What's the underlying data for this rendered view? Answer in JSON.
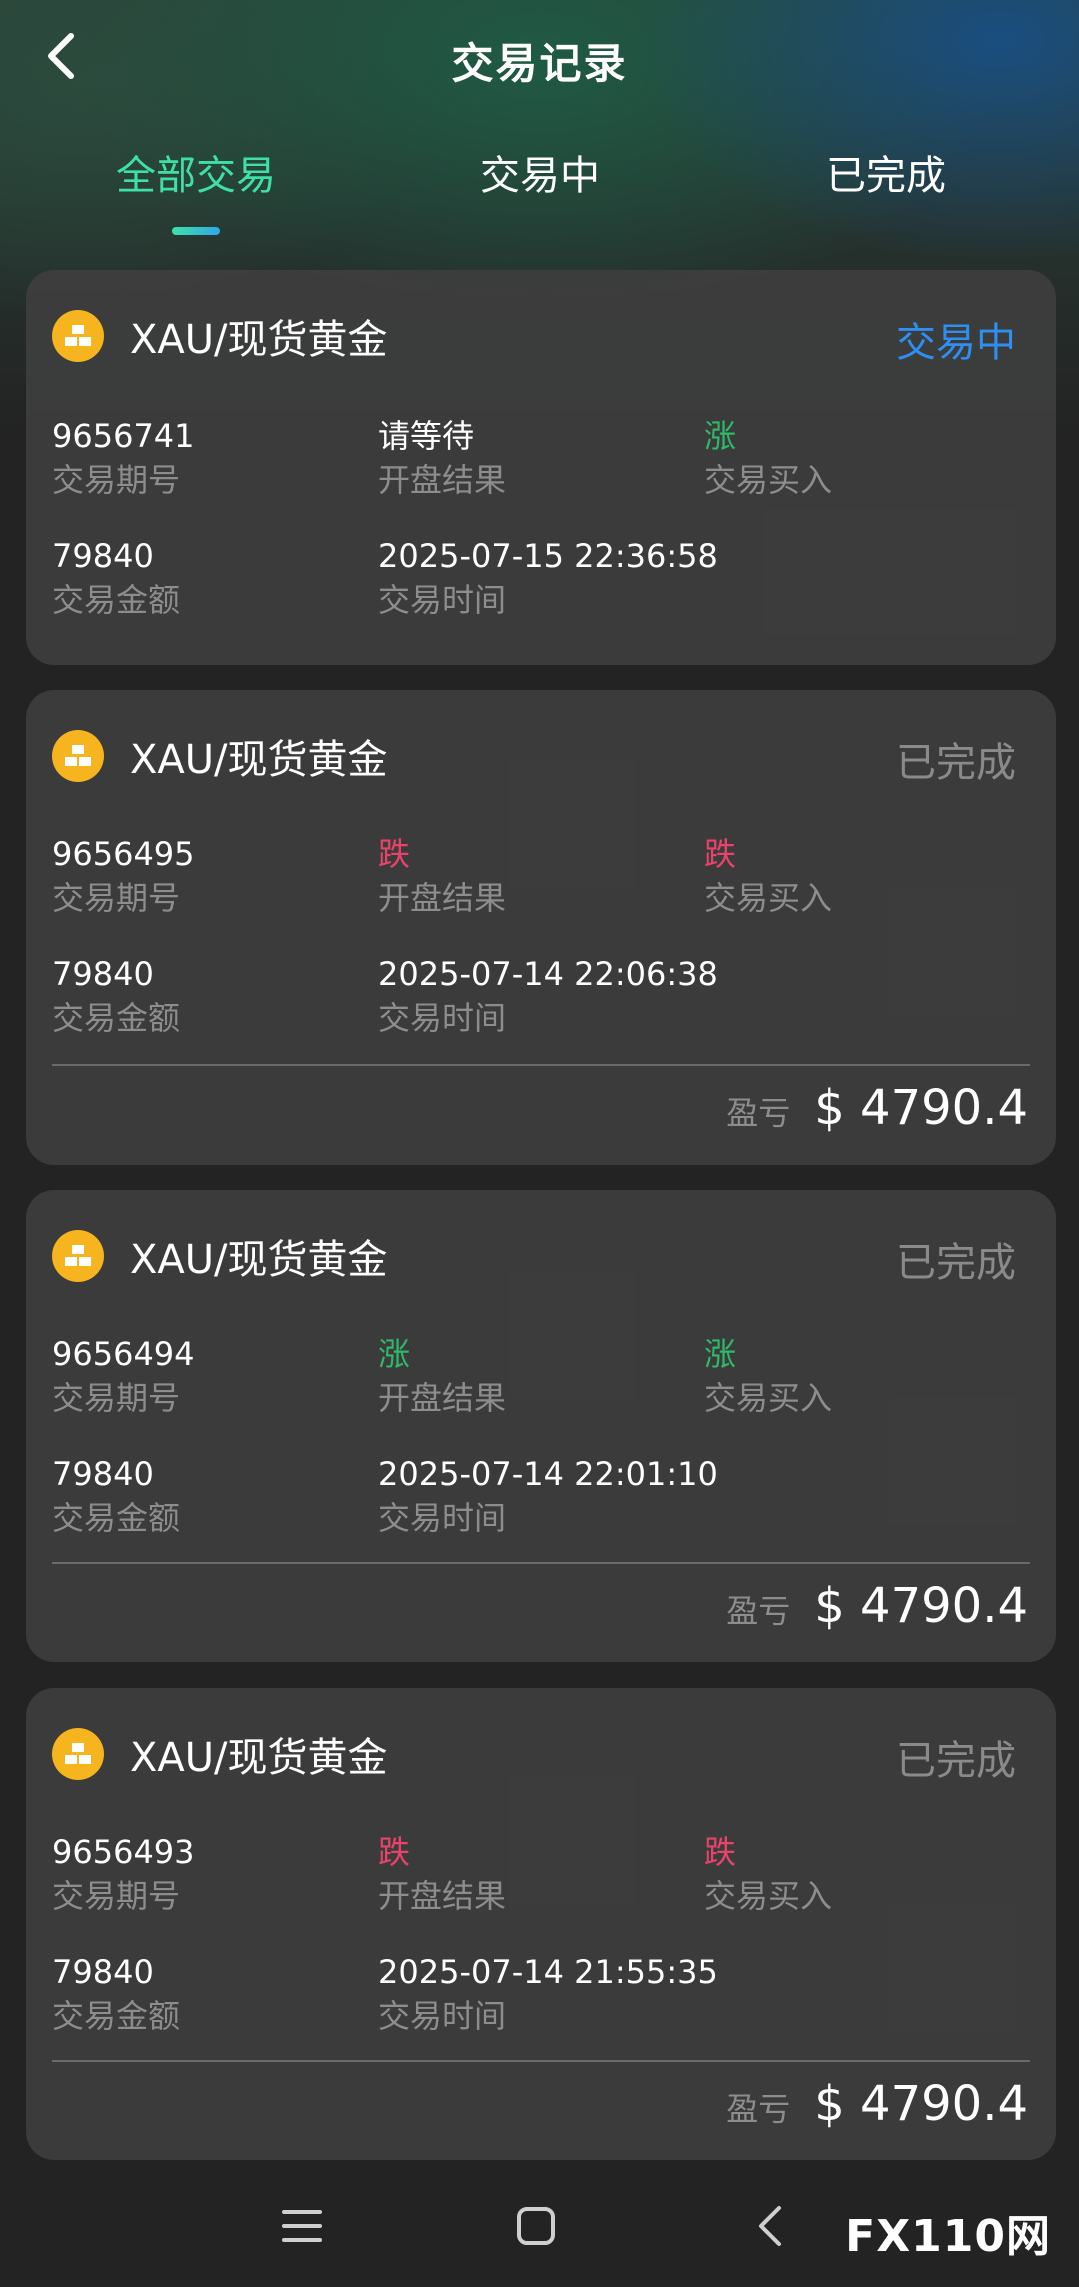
{
  "header": {
    "title": "交易记录"
  },
  "tabs": [
    {
      "label": "全部交易",
      "active": true
    },
    {
      "label": "交易中",
      "active": false
    },
    {
      "label": "已完成",
      "active": false
    }
  ],
  "labels": {
    "period": "交易期号",
    "result": "开盘结果",
    "buy": "交易买入",
    "amount": "交易金额",
    "time": "交易时间",
    "pnl": "盈亏"
  },
  "trades": [
    {
      "symbol": "XAU/现货黄金",
      "status": "交易中",
      "period": "9656741",
      "result": "请等待",
      "buy": "涨",
      "amount": "79840",
      "time": "2025-07-15 22:36:58",
      "pnl": null
    },
    {
      "symbol": "XAU/现货黄金",
      "status": "已完成",
      "period": "9656495",
      "result": "跌",
      "buy": "跌",
      "amount": "79840",
      "time": "2025-07-14 22:06:38",
      "pnl": "$ 4790.4"
    },
    {
      "symbol": "XAU/现货黄金",
      "status": "已完成",
      "period": "9656494",
      "result": "涨",
      "buy": "涨",
      "amount": "79840",
      "time": "2025-07-14 22:01:10",
      "pnl": "$ 4790.4"
    },
    {
      "symbol": "XAU/现货黄金",
      "status": "已完成",
      "period": "9656493",
      "result": "跌",
      "buy": "跌",
      "amount": "79840",
      "time": "2025-07-14 21:55:35",
      "pnl": "$ 4790.4"
    }
  ],
  "colors": {
    "accent_tab": "#3fe0a6",
    "ongoing": "#2f8ff0",
    "up": "#2fb86a",
    "down": "#e8436a",
    "gold": "#f6b41f"
  },
  "icons": {
    "back": "chevron-left-icon",
    "gold": "gold-bars-icon",
    "nav_menu": "menu-icon",
    "nav_home": "home-square-icon",
    "nav_back": "chevron-left-icon"
  },
  "watermark": {
    "brand": "FX110网"
  }
}
